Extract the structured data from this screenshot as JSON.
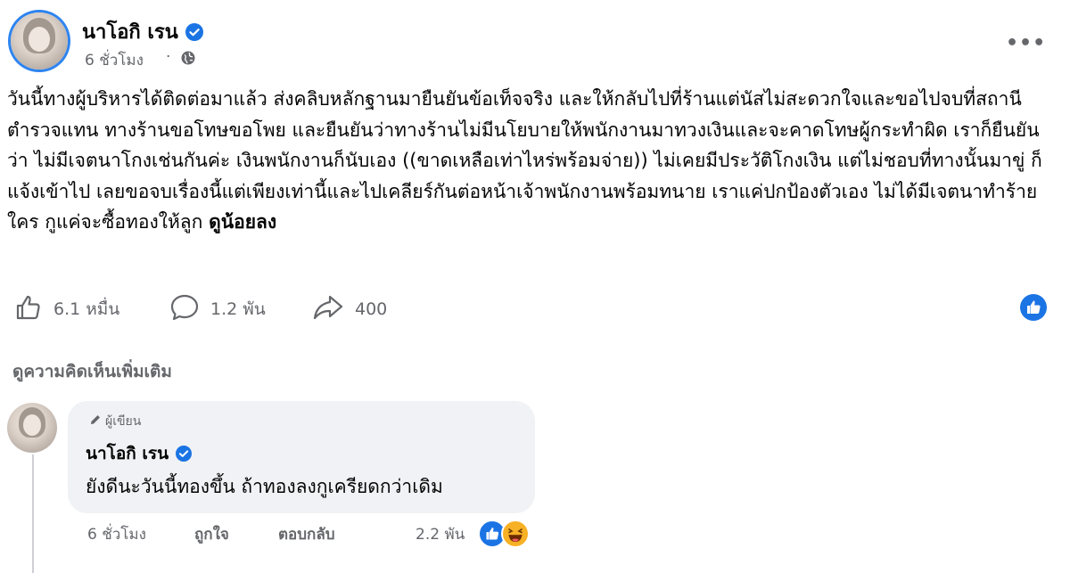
{
  "post": {
    "author_name": "นาโอกิ เรน",
    "time": "6 ชั่วโมง",
    "text": "วันนี้ทางผู้บริหารได้ติดต่อมาแล้ว ส่งคลิบหลักฐานมายืนยันข้อเท็จจริง และให้กลับไปที่ร้านแต่นัสไม่สะดวกใจและขอไปจบที่สถานีตำรวจแทน ทางร้านขอโทษขอโพย และยืนยันว่าทางร้านไม่มีนโยบายให้พนักงานมาทวงเงินและจะคาดโทษผู้กระทำผิด เราก็ยืนยันว่า ไม่มีเจตนาโกงเช่นกันค่ะ เงินพนักงานก็นับเอง ((ขาดเหลือเท่าไหร่พร้อมจ่าย)) ไม่เคยมีประวัติโกงเงิน แต่ไม่ชอบที่ทางนั้นมาขู่ ก็แจ้งเข้าไป เลยขอจบเรื่องนี้แต่เพียงเท่านี้และไปเคลียร์กันต่อหน้าเจ้าพนักงานพร้อมทนาย เราแค่ปกป้องตัวเอง ไม่ได้มีเจตนาทำร้ายใคร กูแค่จะซื้อทองให้ลูก",
    "see_less": "ดูน้อยลง",
    "likes": "6.1 หมื่น",
    "comments": "1.2 พัน",
    "shares": "400"
  },
  "see_more_comments": "ดูความคิดเห็นเพิ่มเติม",
  "comment": {
    "author_tag": "ผู้เขียน",
    "author_name": "นาโอกิ เรน",
    "text": "ยังดีนะวันนี้ทองขึ้น ถ้าทองลงกูเครียดกว่าเดิม",
    "time": "6 ชั่วโมง",
    "like_label": "ถูกใจ",
    "reply_label": "ตอบกลับ",
    "reaction_count": "2.2 พัน"
  },
  "colors": {
    "brand_blue": "#1b74e4",
    "secondary_text": "#65676b",
    "bubble_bg": "#f0f2f5"
  },
  "icons": [
    "verified-badge-icon",
    "globe-icon",
    "more-options-icon",
    "like-icon",
    "comment-icon",
    "share-icon",
    "pencil-icon",
    "haha-reaction-icon"
  ]
}
